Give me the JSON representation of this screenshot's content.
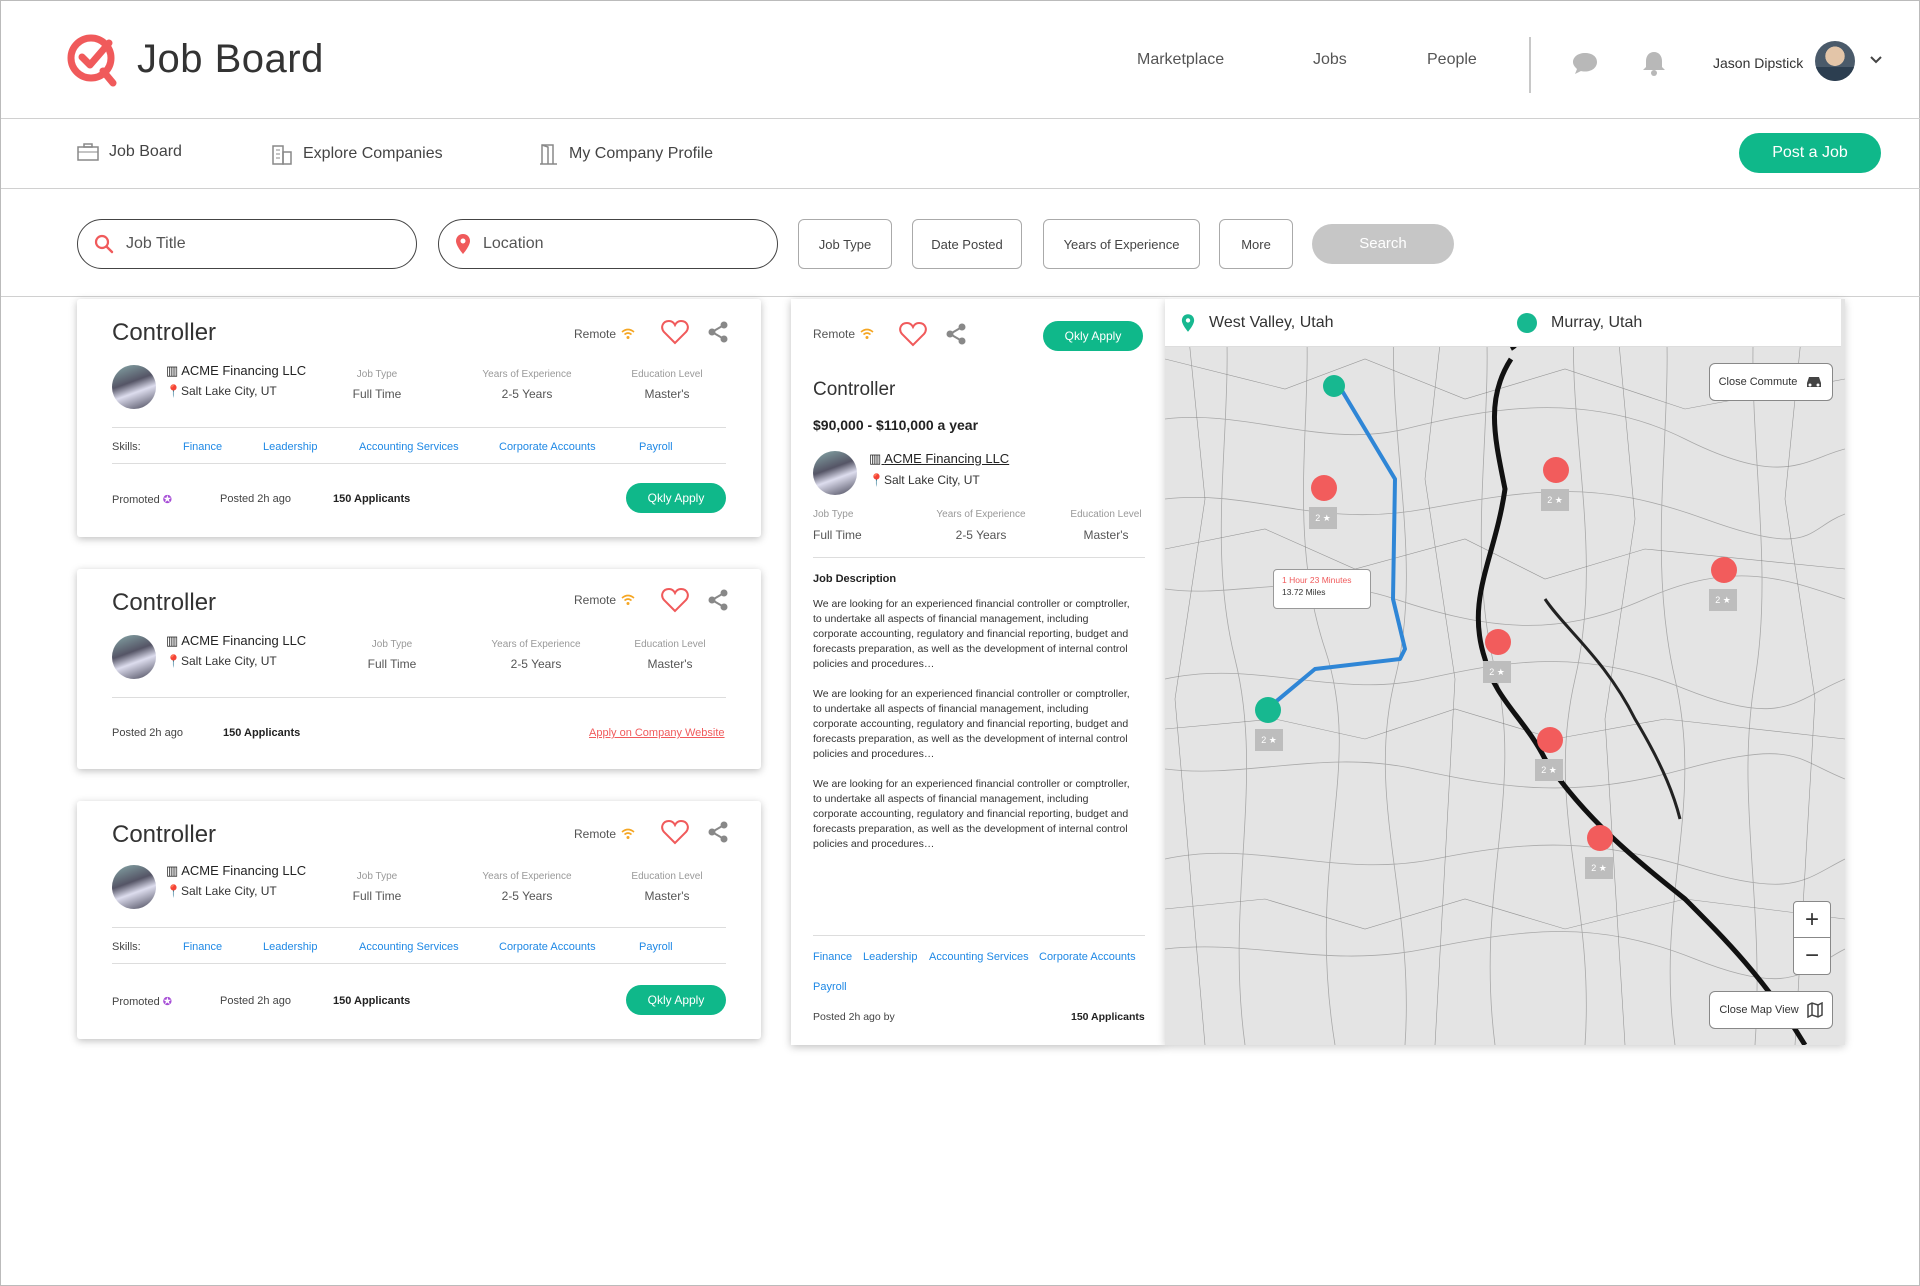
{
  "header": {
    "brand": "Job Board",
    "nav": [
      "Marketplace",
      "Jobs",
      "People"
    ],
    "user_name": "Jason Dipstick",
    "accent": "#f05a5b"
  },
  "subnav": {
    "items": [
      {
        "label": "Job Board",
        "icon": "briefcase-icon"
      },
      {
        "label": "Explore Companies",
        "icon": "buildings-icon"
      },
      {
        "label": "My Company Profile",
        "icon": "door-icon"
      }
    ],
    "post_job": "Post a Job"
  },
  "search": {
    "job_title_placeholder": "Job Title",
    "location_placeholder": "Location",
    "filters": [
      "Job Type",
      "Date Posted",
      "Years of Experience",
      "More"
    ],
    "search_label": "Search"
  },
  "labels": {
    "remote": "Remote",
    "job_type": "Job Type",
    "years": "Years of Experience",
    "education": "Education Level",
    "skills": "Skills:",
    "promoted": "Promoted",
    "qkly_apply": "Qkly Apply",
    "job_description": "Job Description",
    "posted_by": "Posted 2h ago by"
  },
  "jobs": [
    {
      "title": "Controller",
      "company": "ACME Financing LLC",
      "location": "Salt Lake City, UT",
      "job_type": "Full Time",
      "years": "2-5 Years",
      "education": "Master's",
      "posted": "Posted 2h ago",
      "applicants": "150 Applicants",
      "skills": [
        "Finance",
        "Leadership",
        "Accounting Services",
        "Corporate Accounts",
        "Payroll"
      ]
    },
    {
      "title": "Controller",
      "company": "ACME Financing LLC",
      "location": "Salt Lake City, UT",
      "job_type": "Full Time",
      "years": "2-5 Years",
      "education": "Master's",
      "posted": "Posted 2h ago",
      "applicants": "150 Applicants",
      "apply_link": "Apply on Company Website"
    },
    {
      "title": "Controller",
      "company": "ACME Financing LLC",
      "location": "Salt Lake City, UT",
      "job_type": "Full Time",
      "years": "2-5 Years",
      "education": "Master's",
      "posted": "Posted 2h ago",
      "applicants": "150 Applicants",
      "skills": [
        "Finance",
        "Leadership",
        "Accounting Services",
        "Corporate Accounts",
        "Payroll"
      ]
    }
  ],
  "detail": {
    "title": "Controller",
    "salary": "$90,000 - $110,000 a year",
    "company": "ACME Financing LLC",
    "location": "Salt Lake City, UT",
    "job_type": "Full Time",
    "years": "2-5 Years",
    "education": "Master's",
    "description": [
      "We are looking for an experienced financial controller or comptroller, to undertake all aspects of financial management, including corporate accounting, regulatory and financial reporting, budget and forecasts preparation, as well as the development of internal control policies and procedures…",
      "We are looking for an experienced financial controller or comptroller, to undertake all aspects of financial management, including corporate accounting, regulatory and financial reporting, budget and forecasts preparation, as well as the development of internal control policies and procedures…",
      "We are looking for an experienced financial controller or comptroller, to undertake all aspects of financial management, including corporate accounting, regulatory and financial reporting, budget and forecasts preparation, as well as the development of internal control policies and procedures…"
    ],
    "skills": [
      "Finance",
      "Leadership",
      "Accounting Services",
      "Corporate Accounts",
      "Payroll"
    ],
    "applicants": "150 Applicants"
  },
  "map": {
    "from": "West Valley, Utah",
    "to": "Murray, Utah",
    "close_commute": "Close Commute",
    "commute_time": "1 Hour 23 Minutes",
    "commute_distance": "13.72 Miles",
    "close_map_view": "Close Map View",
    "zoom_in": "+",
    "zoom_out": "−",
    "marker_count": "2",
    "route_color": "#2f86d6",
    "pin_color": "#f25c5c",
    "origin_color": "#17b890"
  }
}
